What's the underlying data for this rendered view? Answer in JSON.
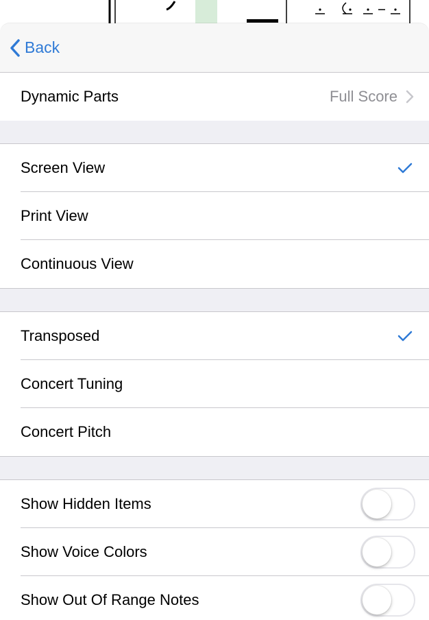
{
  "nav": {
    "back_label": "Back"
  },
  "dynamic_parts": {
    "label": "Dynamic Parts",
    "value": "Full Score"
  },
  "view_options": [
    {
      "label": "Screen View",
      "selected": true
    },
    {
      "label": "Print View",
      "selected": false
    },
    {
      "label": "Continuous View",
      "selected": false
    }
  ],
  "pitch_options": [
    {
      "label": "Transposed",
      "selected": true
    },
    {
      "label": "Concert Tuning",
      "selected": false
    },
    {
      "label": "Concert Pitch",
      "selected": false
    }
  ],
  "toggles": [
    {
      "label": "Show Hidden Items",
      "on": false
    },
    {
      "label": "Show Voice Colors",
      "on": false
    },
    {
      "label": "Show Out Of Range Notes",
      "on": false
    }
  ],
  "colors": {
    "accent": "#2f7ad6",
    "secondary_text": "#8e8e93",
    "separator": "#c8c7cc",
    "group_background": "#efeff4"
  }
}
